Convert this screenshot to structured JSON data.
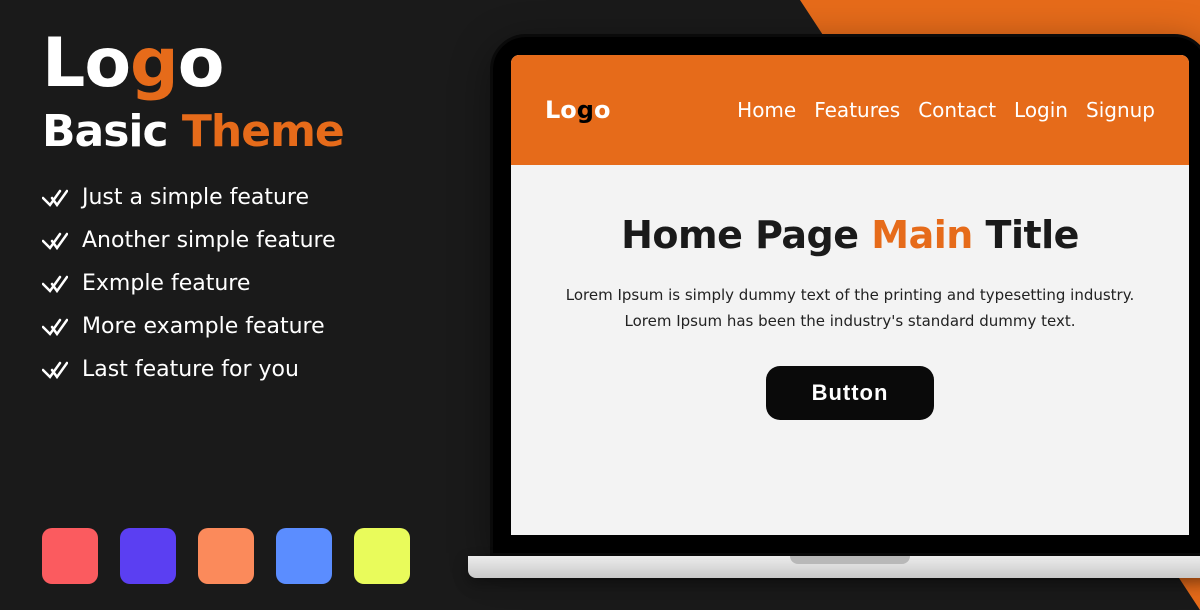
{
  "logo": {
    "pre": "Lo",
    "accent": "g",
    "post": "o"
  },
  "tagline": {
    "pre": "Basic ",
    "accent": "Theme"
  },
  "features": [
    "Just a simple feature",
    "Another simple feature",
    "Exmple feature",
    "More example feature",
    "Last feature for you"
  ],
  "swatches": [
    "#fb5b5f",
    "#5b3ff2",
    "#fb8a5b",
    "#5b8dff",
    "#e9fb5b"
  ],
  "preview": {
    "logo": {
      "pre": "Lo",
      "accent": "g",
      "post": "o"
    },
    "nav": [
      "Home",
      "Features",
      "Contact",
      "Login",
      "Signup"
    ],
    "hero": {
      "title_pre": "Home Page ",
      "title_accent": "Main",
      "title_post": " Title",
      "desc": "Lorem Ipsum is simply dummy text of the printing and typesetting industry. Lorem Ipsum has been the industry's standard dummy text.",
      "button": "Button"
    }
  }
}
